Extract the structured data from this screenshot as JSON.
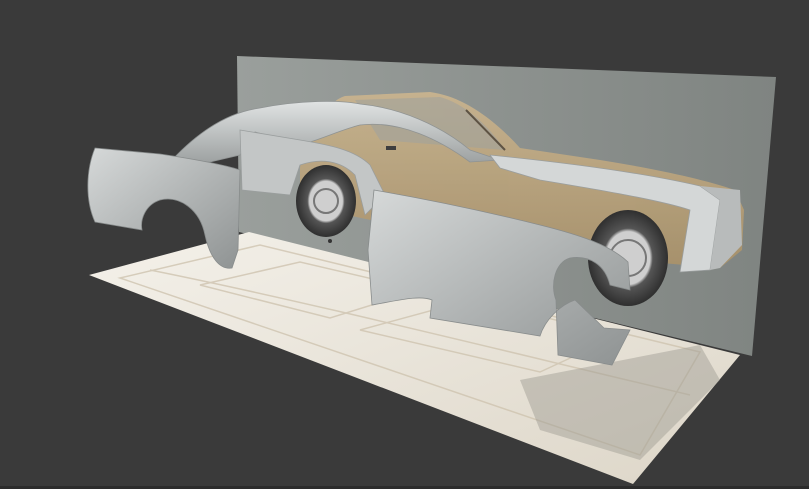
{
  "viewport": {
    "background_color": "#3a3a3a",
    "scene": {
      "backdrop_color": "#8a8e8c",
      "floor_color": "#e8e2d8",
      "reference_tint": "#c7b08a",
      "body_panel_color": "#c9cccc",
      "tire_color": "#3d3d3d",
      "wheel_rim_color": "#bfbfbf"
    }
  }
}
